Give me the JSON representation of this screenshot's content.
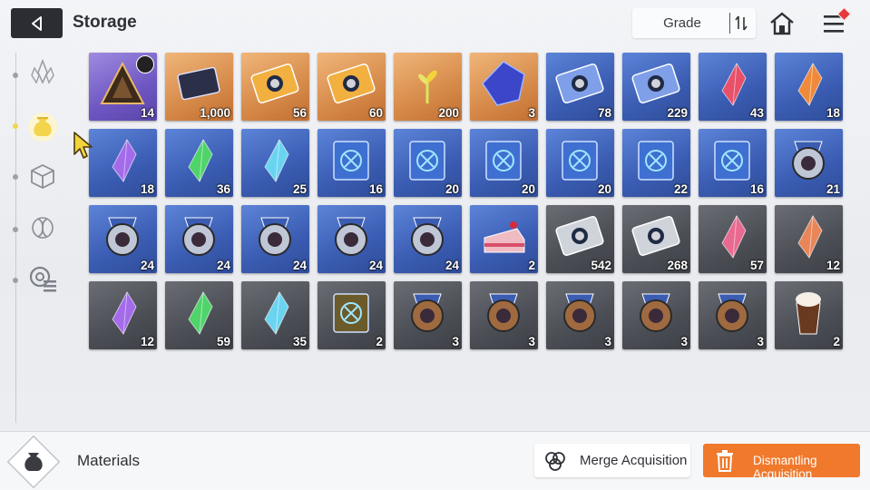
{
  "header": {
    "title": "Storage",
    "grade_label": "Grade"
  },
  "sidebar": {
    "items": [
      {
        "icon": "crystal-icon",
        "active": false
      },
      {
        "icon": "pouch-icon",
        "active": true
      },
      {
        "icon": "cube-icon",
        "active": false
      },
      {
        "icon": "dna-icon",
        "active": false
      },
      {
        "icon": "gear-list-icon",
        "active": false
      }
    ]
  },
  "items": [
    {
      "rarity": "purple",
      "qty": "14",
      "kind": "pyramid",
      "timer": true
    },
    {
      "rarity": "gold",
      "qty": "1,000",
      "kind": "chip"
    },
    {
      "rarity": "gold",
      "qty": "56",
      "kind": "ticket"
    },
    {
      "rarity": "gold",
      "qty": "60",
      "kind": "ticket-compass"
    },
    {
      "rarity": "gold",
      "qty": "200",
      "kind": "sprout"
    },
    {
      "rarity": "gold",
      "qty": "3",
      "kind": "cube-blue"
    },
    {
      "rarity": "blue",
      "qty": "78",
      "kind": "ticket-blue"
    },
    {
      "rarity": "blue",
      "qty": "229",
      "kind": "ticket-compass-blue"
    },
    {
      "rarity": "blue",
      "qty": "43",
      "kind": "crystal-red"
    },
    {
      "rarity": "blue",
      "qty": "18",
      "kind": "crystal-orange"
    },
    {
      "rarity": "blue",
      "qty": "18",
      "kind": "crystal-purple"
    },
    {
      "rarity": "blue",
      "qty": "36",
      "kind": "crystal-green"
    },
    {
      "rarity": "blue",
      "qty": "25",
      "kind": "crystal-cyan"
    },
    {
      "rarity": "blue",
      "qty": "16",
      "kind": "book"
    },
    {
      "rarity": "blue",
      "qty": "20",
      "kind": "book"
    },
    {
      "rarity": "blue",
      "qty": "20",
      "kind": "book"
    },
    {
      "rarity": "blue",
      "qty": "20",
      "kind": "book"
    },
    {
      "rarity": "blue",
      "qty": "22",
      "kind": "book"
    },
    {
      "rarity": "blue",
      "qty": "16",
      "kind": "book"
    },
    {
      "rarity": "blue",
      "qty": "21",
      "kind": "medal"
    },
    {
      "rarity": "blue",
      "qty": "24",
      "kind": "medal"
    },
    {
      "rarity": "blue",
      "qty": "24",
      "kind": "medal"
    },
    {
      "rarity": "blue",
      "qty": "24",
      "kind": "medal"
    },
    {
      "rarity": "blue",
      "qty": "24",
      "kind": "medal"
    },
    {
      "rarity": "blue",
      "qty": "24",
      "kind": "medal"
    },
    {
      "rarity": "blue",
      "qty": "2",
      "kind": "cake"
    },
    {
      "rarity": "gray",
      "qty": "542",
      "kind": "ticket-silver"
    },
    {
      "rarity": "gray",
      "qty": "268",
      "kind": "ticket-compass-silver"
    },
    {
      "rarity": "gray",
      "qty": "57",
      "kind": "crystal-pink"
    },
    {
      "rarity": "gray",
      "qty": "12",
      "kind": "crystal-peach"
    },
    {
      "rarity": "gray",
      "qty": "12",
      "kind": "crystal-purple"
    },
    {
      "rarity": "gray",
      "qty": "59",
      "kind": "crystal-green"
    },
    {
      "rarity": "gray",
      "qty": "35",
      "kind": "crystal-cyan"
    },
    {
      "rarity": "gray",
      "qty": "2",
      "kind": "book-green"
    },
    {
      "rarity": "gray",
      "qty": "3",
      "kind": "medal-bronze"
    },
    {
      "rarity": "gray",
      "qty": "3",
      "kind": "medal-bronze"
    },
    {
      "rarity": "gray",
      "qty": "3",
      "kind": "medal-bronze"
    },
    {
      "rarity": "gray",
      "qty": "3",
      "kind": "medal-bronze"
    },
    {
      "rarity": "gray",
      "qty": "3",
      "kind": "medal-bronze"
    },
    {
      "rarity": "gray",
      "qty": "2",
      "kind": "coffee"
    }
  ],
  "footer": {
    "category_label": "Materials",
    "merge_label": "Merge Acquisition",
    "dismantle_label": "Dismantling Acquisition"
  },
  "colors": {
    "accent_orange": "#f0792c",
    "tile_gold": "#d68a49",
    "tile_blue": "#3a5cb2",
    "tile_purple": "#6e56c2",
    "tile_gray": "#4b4e55"
  }
}
